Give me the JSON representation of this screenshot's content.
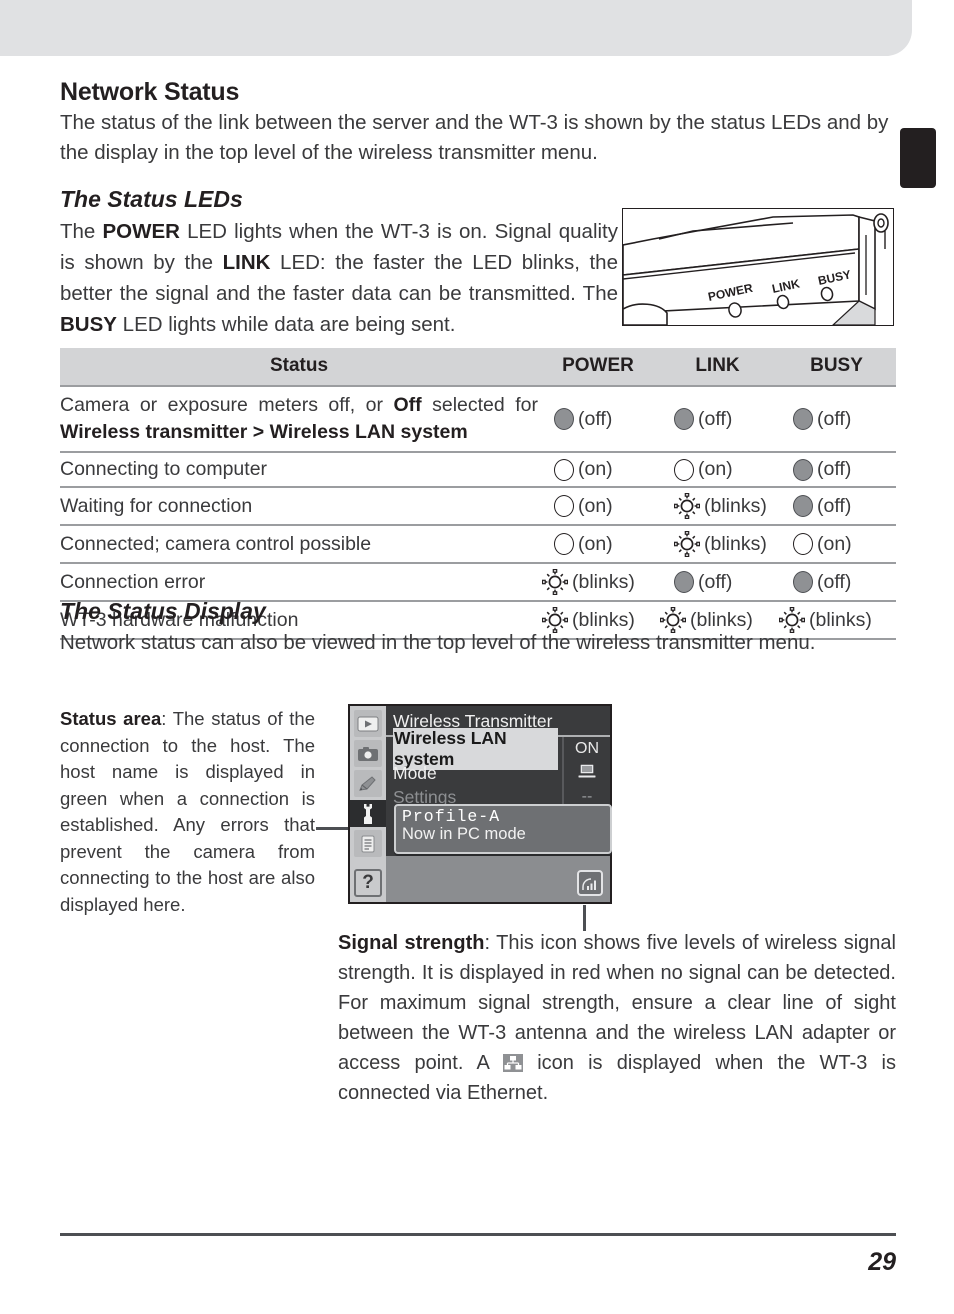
{
  "page": {
    "number": "29"
  },
  "section": {
    "heading": "Network Status",
    "intro": "The status of the link between the server and the WT-3 is shown by the status LEDs and by the display in the top level of the wireless transmitter menu."
  },
  "status_leds": {
    "heading": "The Status LEDs",
    "paragraph_parts": {
      "p1": "The ",
      "b1": "POWER",
      "p2": " LED lights when the WT-3 is on.  Signal quality is shown by the ",
      "b2": "LINK",
      "p3": " LED: the faster the LED blinks, the better the signal and the faster data can be transmitted.  The ",
      "b3": "BUSY",
      "p4": " LED lights while data are being sent."
    },
    "device_labels": {
      "power": "POWER",
      "link": "LINK",
      "busy": "BUSY"
    }
  },
  "table": {
    "headers": {
      "status": "Status",
      "power": "POWER",
      "link": "LINK",
      "busy": "BUSY"
    },
    "rows": [
      {
        "desc_parts": {
          "p1": "Camera or exposure meters off, or ",
          "b1": "Off",
          "p2": " selected for ",
          "b2": "Wireless transmitter",
          "sep": " > ",
          "b3": "Wireless LAN system"
        },
        "power": {
          "state": "off",
          "label": "(off)"
        },
        "link": {
          "state": "off",
          "label": "(off)"
        },
        "busy": {
          "state": "off",
          "label": "(off)"
        }
      },
      {
        "desc": "Connecting to computer",
        "power": {
          "state": "on",
          "label": "(on)"
        },
        "link": {
          "state": "on",
          "label": "(on)"
        },
        "busy": {
          "state": "off",
          "label": "(off)"
        }
      },
      {
        "desc": "Waiting for connection",
        "power": {
          "state": "on",
          "label": "(on)"
        },
        "link": {
          "state": "blinks",
          "label": "(blinks)"
        },
        "busy": {
          "state": "off",
          "label": "(off)"
        }
      },
      {
        "desc": "Connected; camera control possible",
        "power": {
          "state": "on",
          "label": "(on)"
        },
        "link": {
          "state": "blinks",
          "label": "(blinks)"
        },
        "busy": {
          "state": "on",
          "label": "(on)"
        }
      },
      {
        "desc": "Connection error",
        "power": {
          "state": "blinks",
          "label": "(blinks)"
        },
        "link": {
          "state": "off",
          "label": "(off)"
        },
        "busy": {
          "state": "off",
          "label": "(off)"
        }
      },
      {
        "desc": "WT-3 hardware malfunction",
        "power": {
          "state": "blinks",
          "label": "(blinks)"
        },
        "link": {
          "state": "blinks",
          "label": "(blinks)"
        },
        "busy": {
          "state": "blinks",
          "label": "(blinks)"
        }
      }
    ]
  },
  "status_display": {
    "heading": "The Status Display",
    "paragraph": "Network status can also be viewed in the top level of the wireless transmitter menu."
  },
  "callout_status_area": {
    "bold": "Status area",
    "text": ": The status of the connection to the host.  The host name is displayed in green when a connection is established.  Any errors that prevent the camera from connecting to the host are also displayed here."
  },
  "callout_signal_strength": {
    "bold": "Signal strength",
    "text_1": ": This icon shows five levels of wireless signal strength.  It is displayed in red when no signal can be detected.  For maximum signal strength, ensure a clear line of sight between the WT-3 antenna and the wireless LAN adapter or access point.  A ",
    "text_2": " icon is displayed when the WT-3 is connected via Ethernet."
  },
  "lcd": {
    "title": "Wireless Transmitter",
    "menu_items": [
      {
        "label": "Wireless LAN system",
        "value": "ON",
        "highlighted": true,
        "value_icon": "none"
      },
      {
        "label": "Mode",
        "value": "",
        "highlighted": false,
        "value_icon": "computer-icon"
      },
      {
        "label": "Settings",
        "value": "--",
        "highlighted": false,
        "value_icon": "none",
        "dimmed": true
      }
    ],
    "status_area": {
      "profile": "Profile-A",
      "message": "Now in PC mode"
    },
    "sidebar_icons": [
      "playback-icon",
      "shooting-menu-icon",
      "custom-settings-icon",
      "setup-menu-icon",
      "recent-settings-icon"
    ],
    "help_label": "?",
    "signal_icon": "signal-strength-icon"
  },
  "colors": {
    "band": "#e0e1e3",
    "table_header": "#d3d4d6",
    "rule": "#9b9da0",
    "text": "#231f20",
    "body_text": "#3a3a3c",
    "lcd_bg": "#3a3b3d",
    "lcd_highlight": "#d8d9db"
  }
}
